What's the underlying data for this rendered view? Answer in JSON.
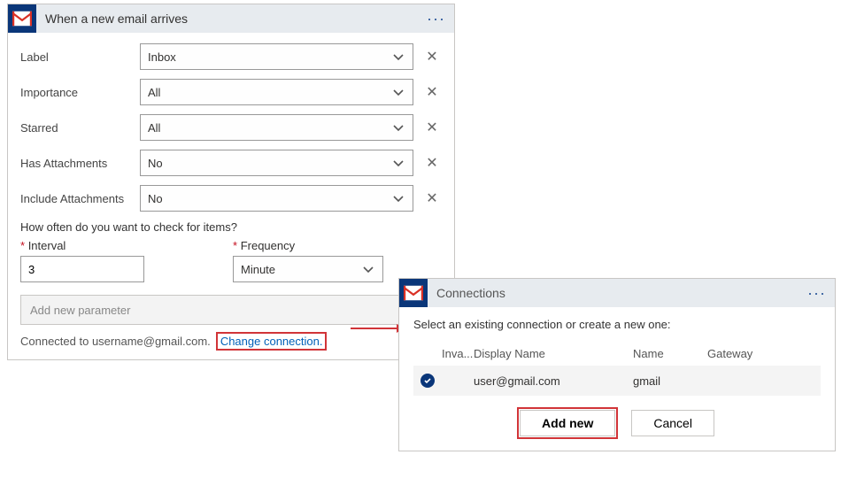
{
  "trigger": {
    "title": "When a new email arrives",
    "fields": [
      {
        "label": "Label",
        "value": "Inbox"
      },
      {
        "label": "Importance",
        "value": "All"
      },
      {
        "label": "Starred",
        "value": "All"
      },
      {
        "label": "Has Attachments",
        "value": "No"
      },
      {
        "label": "Include Attachments",
        "value": "No"
      }
    ],
    "how_often_text": "How often do you want to check for items?",
    "interval_label": "Interval",
    "interval_value": "3",
    "frequency_label": "Frequency",
    "frequency_value": "Minute",
    "add_param_placeholder": "Add new parameter",
    "connected_to_text": "Connected to username@gmail.com.",
    "change_connection_text": "Change connection."
  },
  "connections": {
    "title": "Connections",
    "prompt": "Select an existing connection or create a new one:",
    "headers": {
      "inva": "Inva...",
      "display": "Display Name",
      "name": "Name",
      "gateway": "Gateway"
    },
    "row": {
      "display": "user@gmail.com",
      "name": "gmail"
    },
    "add_new": "Add new",
    "cancel": "Cancel"
  }
}
